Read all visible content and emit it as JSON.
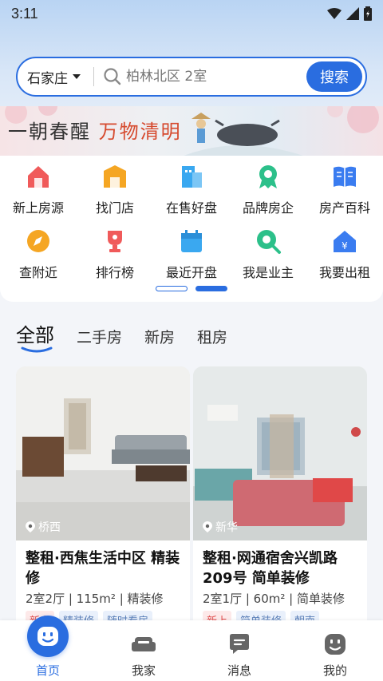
{
  "status": {
    "time": "3:11"
  },
  "search": {
    "city": "石家庄",
    "placeholder": "柏林北区 2室",
    "button_label": "搜索"
  },
  "banner": {
    "text_main": "一朝春醒",
    "text_highlight": "万物清明"
  },
  "quick_links": [
    {
      "label": "新上房源",
      "icon": "new-house-icon",
      "color": "#f05a5a"
    },
    {
      "label": "找门店",
      "icon": "store-icon",
      "color": "#f5a623"
    },
    {
      "label": "在售好盘",
      "icon": "building-icon",
      "color": "#3aa8f0"
    },
    {
      "label": "品牌房企",
      "icon": "badge-icon",
      "color": "#2cc08a"
    },
    {
      "label": "房产百科",
      "icon": "book-icon",
      "color": "#3a7cf0"
    },
    {
      "label": "查附近",
      "icon": "compass-icon",
      "color": "#f5a623"
    },
    {
      "label": "排行榜",
      "icon": "trophy-icon",
      "color": "#f05a5a"
    },
    {
      "label": "最近开盘",
      "icon": "calendar-icon",
      "color": "#3aa8f0"
    },
    {
      "label": "我是业主",
      "icon": "owner-search-icon",
      "color": "#2cc08a"
    },
    {
      "label": "我要出租",
      "icon": "rent-icon",
      "color": "#3a7cf0"
    }
  ],
  "tabs": [
    {
      "label": "全部",
      "active": true
    },
    {
      "label": "二手房",
      "active": false
    },
    {
      "label": "新房",
      "active": false
    },
    {
      "label": "租房",
      "active": false
    }
  ],
  "listings": [
    {
      "location": "桥西",
      "title": "整租·西焦生活中区 精装修",
      "meta": "2室2厅 | 115m² | 精装修",
      "tags": [
        "新上",
        "精装修",
        "随时看房"
      ]
    },
    {
      "location": "新华",
      "title": "整租·网通宿舍兴凯路209号 简单装修",
      "meta": "2室1厅 | 60m² | 简单装修",
      "tags": [
        "新上",
        "简单装修",
        "朝南"
      ]
    }
  ],
  "bottom_nav": [
    {
      "label": "首页",
      "icon": "home-face-icon",
      "active": true
    },
    {
      "label": "我家",
      "icon": "sofa-icon",
      "active": false
    },
    {
      "label": "消息",
      "icon": "message-icon",
      "active": false
    },
    {
      "label": "我的",
      "icon": "profile-face-icon",
      "active": false
    }
  ],
  "colors": {
    "primary": "#2a6de0",
    "background": "#f3f5f9"
  }
}
